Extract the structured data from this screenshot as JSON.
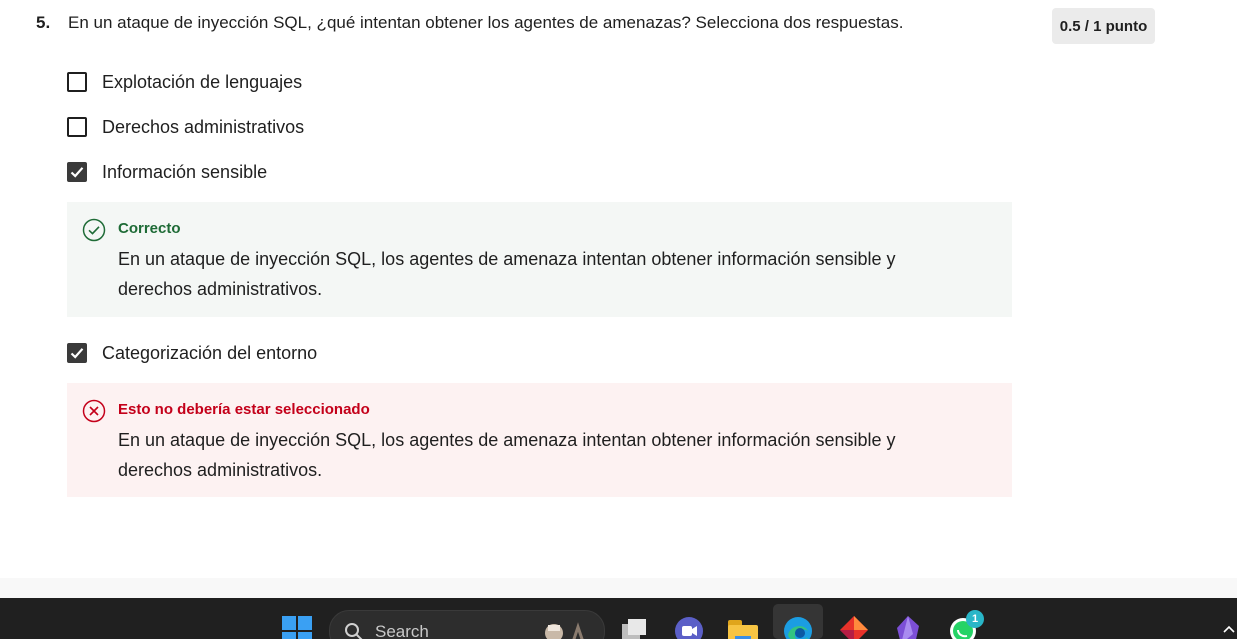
{
  "question": {
    "number": "5.",
    "text": "En un ataque de inyección SQL, ¿qué intentan obtener los agentes de amenazas? Selecciona dos respuestas.",
    "score": "0.5 / 1 punto"
  },
  "options": [
    {
      "label": "Explotación de lenguajes",
      "checked": false
    },
    {
      "label": "Derechos administrativos",
      "checked": false
    },
    {
      "label": "Información sensible",
      "checked": true
    },
    {
      "label": "Categorización del entorno",
      "checked": true
    }
  ],
  "feedback_correct": {
    "title": "Correcto",
    "text": "En un ataque de inyección SQL, los agentes de amenaza intentan obtener información sensible y derechos administrativos.",
    "color": "#1e6b36",
    "icon": "check-circle-icon"
  },
  "feedback_incorrect": {
    "title": "Esto no debería estar seleccionado",
    "text": "En un ataque de inyección SQL, los agentes de amenaza intentan obtener información sensible y derechos administrativos.",
    "color": "#c4001a",
    "icon": "x-circle-icon"
  },
  "taskbar": {
    "search_label": "Search",
    "whatsapp_badge": "1"
  }
}
